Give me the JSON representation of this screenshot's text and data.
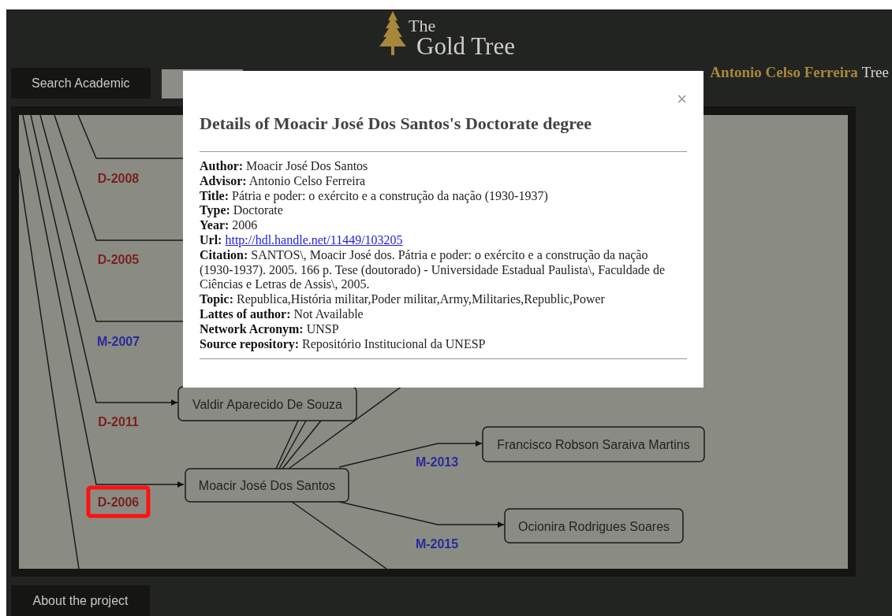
{
  "logo": {
    "line1": "The",
    "line2": "Gold Tree"
  },
  "nav": [
    {
      "kind": "dark",
      "label": "Search Academic"
    },
    {
      "kind": "light"
    }
  ],
  "tree_title": {
    "name": "Antonio Celso Ferreira",
    "suffix": "Tree"
  },
  "graph": {
    "labels": [
      {
        "text": "D-2008",
        "color": "#7a1f1f",
        "highlighted": false
      },
      {
        "text": "D-2005",
        "color": "#7a1f1f",
        "highlighted": false
      },
      {
        "text": "M-2007",
        "color": "#2a2a9a",
        "highlighted": false
      },
      {
        "text": "D-2011",
        "color": "#7a1f1f",
        "highlighted": false
      },
      {
        "text": "D-2006",
        "color": "#7a1f1f",
        "highlighted": true
      },
      {
        "text": "M-2013",
        "color": "#2a2a9a",
        "highlighted": false
      },
      {
        "text": "M-2015",
        "color": "#2a2a9a",
        "highlighted": false
      }
    ],
    "nodes": [
      {
        "name": "Valdir Aparecido De Souza"
      },
      {
        "name": "Moacir José Dos Santos"
      },
      {
        "name": "Francisco Robson Saraiva Martins"
      },
      {
        "name": "Ocionira Rodrigues Soares"
      }
    ]
  },
  "modal": {
    "close": "×",
    "title": "Details of Moacir José Dos Santos's Doctorate degree",
    "fields": [
      {
        "label": "Author:",
        "value": "Moacir José Dos Santos",
        "kind": "text"
      },
      {
        "label": "Advisor:",
        "value": "Antonio Celso Ferreira",
        "kind": "text"
      },
      {
        "label": "Title:",
        "value": "Pátria e poder: o exército e a construção da nação (1930-1937)",
        "kind": "text"
      },
      {
        "label": "Type:",
        "value": "Doctorate",
        "kind": "text"
      },
      {
        "label": "Year:",
        "value": "2006",
        "kind": "text"
      },
      {
        "label": "Url:",
        "value": "http://hdl.handle.net/11449/103205",
        "kind": "link"
      },
      {
        "label": "Citation:",
        "value": "SANTOS\\, Moacir José dos. Pátria e poder: o exército e a construção da nação (1930-1937). 2005. 166 p. Tese (doutorado) - Universidade Estadual Paulista\\, Faculdade de Ciências e Letras de Assis\\, 2005.",
        "kind": "text"
      },
      {
        "label": "Topic:",
        "value": "Republica,História militar,Poder militar,Army,Militaries,Republic,Power",
        "kind": "text"
      },
      {
        "label": "Lattes of author:",
        "value": "Not Available",
        "kind": "text"
      },
      {
        "label": "Network Acronym:",
        "value": "UNSP",
        "kind": "text"
      },
      {
        "label": "Source repository:",
        "value": "Repositório Institucional da UNESP",
        "kind": "text"
      }
    ]
  },
  "footer": {
    "label": "About the project"
  }
}
